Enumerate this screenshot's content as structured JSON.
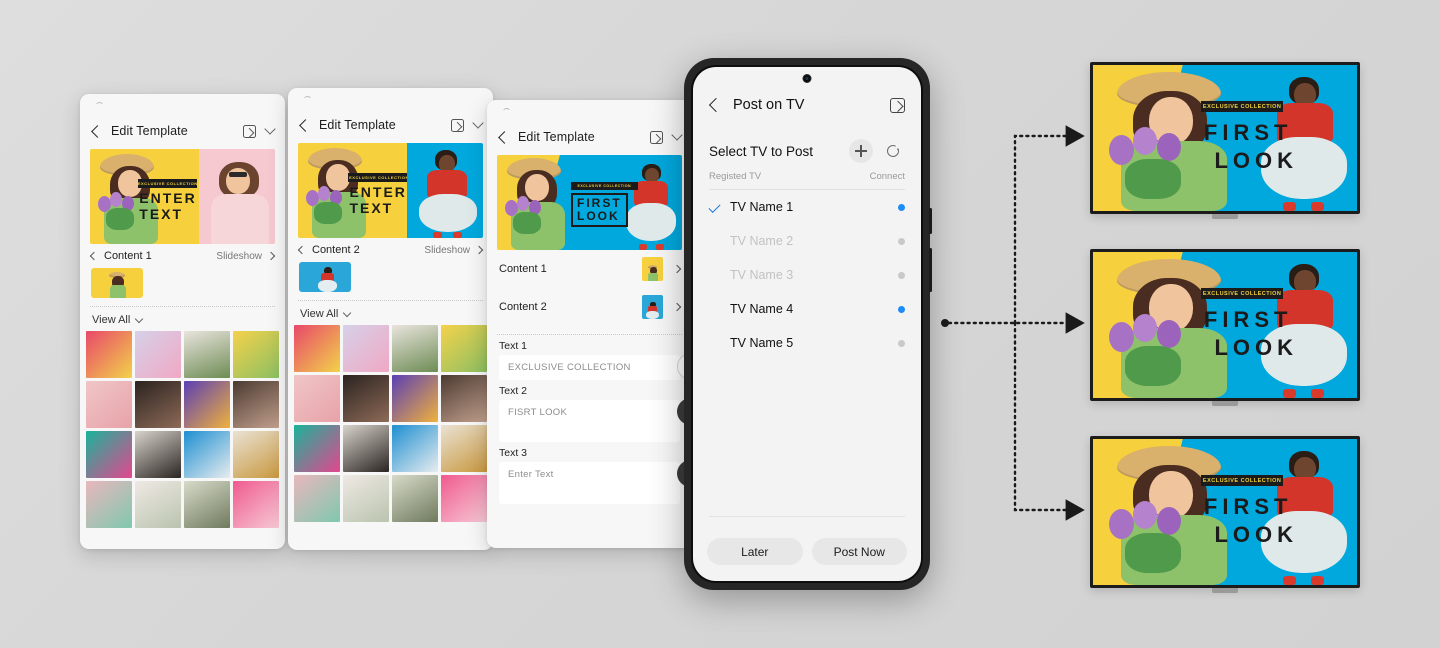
{
  "background": {
    "color": "#d8d8d8"
  },
  "cards": [
    {
      "id": "card-1",
      "title": "Edit Template",
      "content_label": "Content 1",
      "slideshow_label": "Slideshow",
      "view_all_label": "View All",
      "banner_text": "EXCLUSIVE COLLECTION",
      "headline_line1": "ENTER",
      "headline_line2": "TEXT",
      "right_panel_color": "#f3b9c6"
    },
    {
      "id": "card-2",
      "title": "Edit Template",
      "content_label": "Content 2",
      "slideshow_label": "Slideshow",
      "view_all_label": "View All",
      "banner_text": "EXCLUSIVE COLLECTION",
      "headline_line1": "ENTER",
      "headline_line2": "TEXT",
      "right_panel_color": "#00a8dd"
    },
    {
      "id": "card-3",
      "title": "Edit Template",
      "banner_text": "EXCLUSIVE COLLECTION",
      "headline_line1": "FIRST",
      "headline_line2": "LOOK",
      "right_panel_color": "#00a8dd",
      "rows": [
        {
          "label": "Content 1",
          "thumb_color": "#f7d13d"
        },
        {
          "label": "Content 2",
          "thumb_color": "#2aa7d8"
        }
      ],
      "fields": [
        {
          "label": "Text 1",
          "value": "EXCLUSIVE COLLECTION",
          "knob": "hollow"
        },
        {
          "label": "Text 2",
          "value": "FISRT LOOK",
          "knob": "dark"
        },
        {
          "label": "Text 3",
          "value": "Enter Text",
          "knob": "dark"
        }
      ]
    }
  ],
  "phone": {
    "header": {
      "title": "Post on TV",
      "back_icon": "chevron-left-icon",
      "expand_icon": "expand-icon"
    },
    "section": {
      "title": "Select TV to Post",
      "add_icon": "plus-icon",
      "refresh_icon": "refresh-icon",
      "col_left": "Registed TV",
      "col_right": "Connect"
    },
    "tv_list": [
      {
        "name": "TV Name 1",
        "selected": true,
        "enabled": true,
        "connected": true
      },
      {
        "name": "TV Name 2",
        "selected": false,
        "enabled": false,
        "connected": false
      },
      {
        "name": "TV Name 3",
        "selected": false,
        "enabled": false,
        "connected": false
      },
      {
        "name": "TV Name 4",
        "selected": false,
        "enabled": true,
        "connected": true
      },
      {
        "name": "TV Name 5",
        "selected": false,
        "enabled": true,
        "connected": false
      }
    ],
    "buttons": {
      "later": "Later",
      "post_now": "Post Now"
    },
    "accent_color": "#1f8bf5"
  },
  "tvs": [
    {
      "id": "tv-1",
      "banner_text": "EXCLUSIVE COLLECTION",
      "headline_line1": "FIRST",
      "headline_line2": "LOOK"
    },
    {
      "id": "tv-2",
      "banner_text": "EXCLUSIVE COLLECTION",
      "headline_line1": "FIRST",
      "headline_line2": "LOOK"
    },
    {
      "id": "tv-3",
      "banner_text": "EXCLUSIVE COLLECTION",
      "headline_line1": "FIRST",
      "headline_line2": "LOOK"
    }
  ],
  "colors": {
    "brand_yellow": "#f7d13d",
    "brand_cyan": "#00a8dd",
    "brand_pink": "#f3b9c6",
    "ink": "#1b1b1b"
  }
}
